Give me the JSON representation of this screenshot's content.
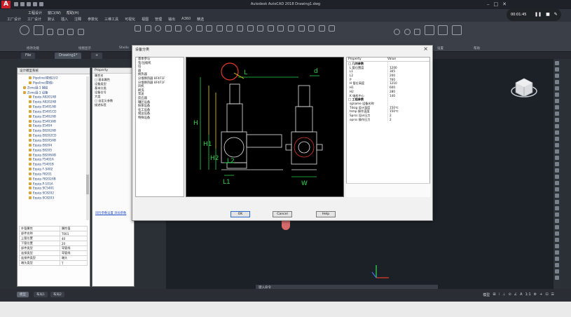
{
  "window": {
    "title": "Autodesk AutoCAD 2018   Drawing1.dwg"
  },
  "menu": {
    "row1": [
      "工程设计",
      "窗口(W)",
      "帮助(H)"
    ],
    "row2": [
      "工厂设计",
      "工厂设计",
      "默认",
      "插入",
      "注释",
      "参数化",
      "三维工具",
      "可视化",
      "视图",
      "管理",
      "输出",
      "A360",
      "精选"
    ]
  },
  "ribbon": {
    "labels": [
      "修改功能",
      "绘图显示",
      "Shello",
      "设置",
      "帮助"
    ]
  },
  "doc_tabs": [
    "File",
    "Drawing1*",
    "+"
  ],
  "left_panel": {
    "title": "设计模型系统",
    "tree": [
      "Pipeline(管线2)/2",
      "Pipeline(管线)",
      "Zone组-1 钢结",
      "Zone组-1 设备",
      "Equip.A8201AB",
      "Equip.A8202AB",
      "Equip.E5401AB",
      "Equip.E5401CD",
      "Equip.E5402AB",
      "Equip.E5403AB",
      "Equip.E5404",
      "Equip.E8202AB",
      "Equip.E8202CD",
      "Equip.E8205AB",
      "Equip.E8204",
      "Equip.E8205",
      "Equip.E8206AB",
      "Equip.F5401A",
      "Equip.F5401B",
      "Equip.F-5402",
      "Equip.F8201",
      "Equip.F8202AB",
      "Equip.P-101A",
      "Equip.SC5401",
      "Equip.SC8202",
      "Equip.SC8203"
    ],
    "props": [
      [
        "外管属性",
        "属性值"
      ],
      [
        "部件名称",
        "T001"
      ],
      [
        "上管位置",
        "40"
      ],
      [
        "下管位置",
        "20"
      ],
      [
        "部件类型",
        "弯管线"
      ],
      [
        "连接类型",
        "弯管线"
      ],
      [
        "连接件类型",
        "端头"
      ],
      [
        "端头类型",
        "T"
      ]
    ],
    "bottom_tabs": [
      "设备",
      "连接/器件",
      "设备库"
    ]
  },
  "property_panel": {
    "header": "Property",
    "rows": [
      "属性名",
      "□ 基本属性",
      "设备类型",
      "基本分类",
      "设备位号",
      "大类",
      "□ 自定义参数",
      "描述标签"
    ],
    "link": "风险参数设置 添加参数"
  },
  "dialog": {
    "title": "设备分类",
    "list": [
      "基本参与",
      "泵/压缩机",
      "塔",
      "器",
      "换热器",
      "分馏换热器 8F4F1F",
      "分馏换热器 8F4F1F",
      "风机",
      "刷洗",
      "泵送",
      "反应器",
      "罐区设备",
      "粉体设备",
      "化工设备",
      "储运设备",
      "特殊设备"
    ],
    "props_header": [
      "Property",
      "Value"
    ],
    "props": [
      [
        "□ 几何参数",
        ""
      ],
      [
        "L 管位置度",
        "1200"
      ],
      [
        "L1",
        "305"
      ],
      [
        "L2",
        "200"
      ],
      [
        "P",
        "760"
      ],
      [
        "H 管位高度",
        "1210"
      ],
      [
        "H1",
        "600"
      ],
      [
        "H2",
        "280"
      ],
      [
        "K 电机中心",
        "140"
      ],
      [
        "□ 工程参数",
        ""
      ],
      [
        "sgname 设备名称",
        ""
      ],
      [
        "Tdsig 设计温度",
        "150℃"
      ],
      [
        "tsmp 操作温度",
        "150℃"
      ],
      [
        "Sprss 设计压力",
        "2"
      ],
      [
        "oprss 操作压力",
        "2"
      ]
    ],
    "drawing_labels": {
      "L": "L",
      "d": "d",
      "H": "H",
      "H1": "H1",
      "H2": "H2",
      "L1": "L1",
      "L2": "L2",
      "W": "W"
    },
    "buttons": {
      "ok": "OK",
      "cancel": "Cancel",
      "help": "Help"
    }
  },
  "canvas": {
    "command_placeholder": "键入命令"
  },
  "recorder": {
    "time": "00:01:45"
  },
  "status": {
    "tabs": [
      "模型",
      "布局1",
      "布局2"
    ],
    "right": [
      "模型",
      "⊞",
      "⁞",
      "⊥",
      "⊙",
      "∠",
      "A",
      "1:1",
      "⚙",
      "+",
      "⊡",
      "☰"
    ]
  },
  "colors": {
    "accent": "#c8202b",
    "cad_yellow": "#e6d51d",
    "cad_green": "#2fd24c",
    "cad_red": "#e03b2a",
    "cad_white": "#e8e8e8"
  }
}
